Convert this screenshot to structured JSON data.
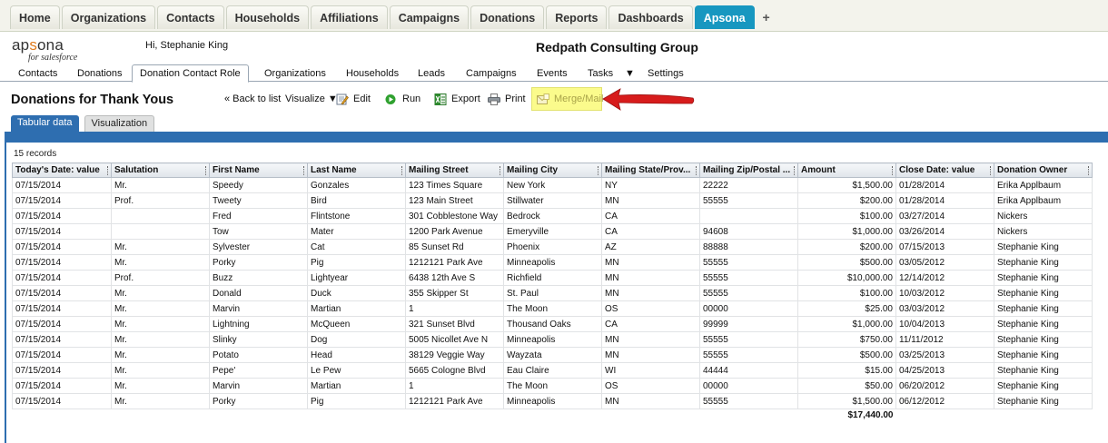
{
  "sf_tabs": [
    "Home",
    "Organizations",
    "Contacts",
    "Households",
    "Affiliations",
    "Campaigns",
    "Donations",
    "Reports",
    "Dashboards",
    "Apsona"
  ],
  "sf_active_tab": "Apsona",
  "sf_plus": "+",
  "brand": {
    "name": "apsona",
    "tagline": "for salesforce"
  },
  "greeting": "Hi, Stephanie King",
  "org_name": "Redpath Consulting Group",
  "sub_tabs": [
    "Contacts",
    "Donations",
    "Donation Contact Role",
    "Organizations",
    "Households",
    "Leads",
    "Campaigns",
    "Events",
    "Tasks",
    "▼",
    "Settings"
  ],
  "page_title": "Donations for Thank Yous",
  "toolbar": {
    "back": "« Back to list",
    "visualize": "Visualize ▼",
    "edit": "Edit",
    "run": "Run",
    "export": "Export",
    "print": "Print",
    "merge": "Merge/Mail"
  },
  "view_tabs": {
    "tabular": "Tabular data",
    "visualization": "Visualization"
  },
  "records_count": "15 records",
  "colors": {
    "accent_blue": "#2e6eb0",
    "active_tab": "#1797c0",
    "highlight": "#fbfb8c",
    "arrow_red": "#d71c1c"
  },
  "table": {
    "columns": [
      "Today's Date: value",
      "Salutation",
      "First Name",
      "Last Name",
      "Mailing Street",
      "Mailing City",
      "Mailing State/Prov...",
      "Mailing Zip/Postal ...",
      "Amount",
      "Close Date: value",
      "Donation Owner"
    ],
    "rows": [
      [
        "07/15/2014",
        "Mr.",
        "Speedy",
        "Gonzales",
        "123 Times Square",
        "New York",
        "NY",
        "22222",
        "$1,500.00",
        "01/28/2014",
        "Erika Applbaum"
      ],
      [
        "07/15/2014",
        "Prof.",
        "Tweety",
        "Bird",
        "123 Main Street",
        "Stillwater",
        "MN",
        "55555",
        "$200.00",
        "01/28/2014",
        "Erika Applbaum"
      ],
      [
        "07/15/2014",
        "",
        "Fred",
        "Flintstone",
        "301 Cobblestone Way",
        "Bedrock",
        "CA",
        "",
        "$100.00",
        "03/27/2014",
        "Nickers"
      ],
      [
        "07/15/2014",
        "",
        "Tow",
        "Mater",
        "1200 Park Avenue",
        "Emeryville",
        "CA",
        "94608",
        "$1,000.00",
        "03/26/2014",
        "Nickers"
      ],
      [
        "07/15/2014",
        "Mr.",
        "Sylvester",
        "Cat",
        "85 Sunset Rd",
        "Phoenix",
        "AZ",
        "88888",
        "$200.00",
        "07/15/2013",
        "Stephanie King"
      ],
      [
        "07/15/2014",
        "Mr.",
        "Porky",
        "Pig",
        "1212121 Park Ave",
        "Minneapolis",
        "MN",
        "55555",
        "$500.00",
        "03/05/2012",
        "Stephanie King"
      ],
      [
        "07/15/2014",
        "Prof.",
        "Buzz",
        "Lightyear",
        "6438 12th Ave S",
        "Richfield",
        "MN",
        "55555",
        "$10,000.00",
        "12/14/2012",
        "Stephanie King"
      ],
      [
        "07/15/2014",
        "Mr.",
        "Donald",
        "Duck",
        "355 Skipper St",
        "St. Paul",
        "MN",
        "55555",
        "$100.00",
        "10/03/2012",
        "Stephanie King"
      ],
      [
        "07/15/2014",
        "Mr.",
        "Marvin",
        "Martian",
        "1",
        "The Moon",
        "OS",
        "00000",
        "$25.00",
        "03/03/2012",
        "Stephanie King"
      ],
      [
        "07/15/2014",
        "Mr.",
        "Lightning",
        "McQueen",
        "321 Sunset Blvd",
        "Thousand Oaks",
        "CA",
        "99999",
        "$1,000.00",
        "10/04/2013",
        "Stephanie King"
      ],
      [
        "07/15/2014",
        "Mr.",
        "Slinky",
        "Dog",
        "5005 Nicollet Ave N",
        "Minneapolis",
        "MN",
        "55555",
        "$750.00",
        "11/11/2012",
        "Stephanie King"
      ],
      [
        "07/15/2014",
        "Mr.",
        "Potato",
        "Head",
        "38129 Veggie Way",
        "Wayzata",
        "MN",
        "55555",
        "$500.00",
        "03/25/2013",
        "Stephanie King"
      ],
      [
        "07/15/2014",
        "Mr.",
        "Pepe'",
        "Le Pew",
        "5665 Cologne Blvd",
        "Eau Claire",
        "WI",
        "44444",
        "$15.00",
        "04/25/2013",
        "Stephanie King"
      ],
      [
        "07/15/2014",
        "Mr.",
        "Marvin",
        "Martian",
        "1",
        "The Moon",
        "OS",
        "00000",
        "$50.00",
        "06/20/2012",
        "Stephanie King"
      ],
      [
        "07/15/2014",
        "Mr.",
        "Porky",
        "Pig",
        "1212121 Park Ave",
        "Minneapolis",
        "MN",
        "55555",
        "$1,500.00",
        "06/12/2012",
        "Stephanie King"
      ]
    ],
    "total_amount": "$17,440.00"
  }
}
